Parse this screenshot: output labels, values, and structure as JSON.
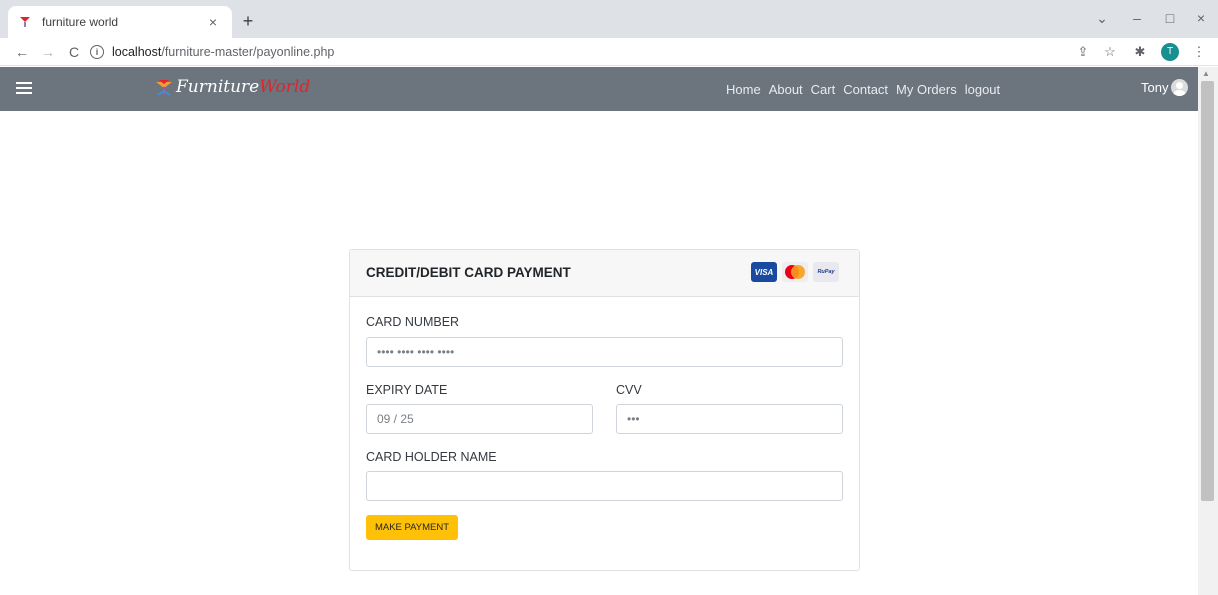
{
  "browser": {
    "tab_title": "furniture world",
    "tab_close": "×",
    "new_tab": "+",
    "url_host": "localhost",
    "url_path": "/furniture-master/payonline.php",
    "profile_initial": "T",
    "controls": {
      "minimize": "–",
      "maximize": "□",
      "close": "×",
      "tab_search": "⌄"
    },
    "nav": {
      "back": "←",
      "forward": "→",
      "reload": "C"
    }
  },
  "navbar": {
    "brand_part1": "Furniture",
    "brand_part2": "World",
    "links": [
      "Home",
      "About",
      "Cart",
      "Contact",
      "My Orders",
      "logout"
    ],
    "user_name": "Tony"
  },
  "payment": {
    "title": "CREDIT/DEBIT CARD PAYMENT",
    "logos": {
      "visa": "VISA",
      "rupay": "RuPay"
    },
    "card_number_label": "CARD NUMBER",
    "card_number_placeholder": "•••• •••• •••• ••••",
    "expiry_label": "EXPIRY DATE",
    "expiry_placeholder": "09 / 25",
    "cvv_label": "CVV",
    "cvv_placeholder": "•••",
    "holder_label": "CARD HOLDER NAME",
    "holder_placeholder": "",
    "submit_label": "MAKE PAYMENT"
  },
  "colors": {
    "navbar_bg": "#6c757d",
    "button_bg": "#ffc107",
    "brand_accent": "#e0242b"
  }
}
